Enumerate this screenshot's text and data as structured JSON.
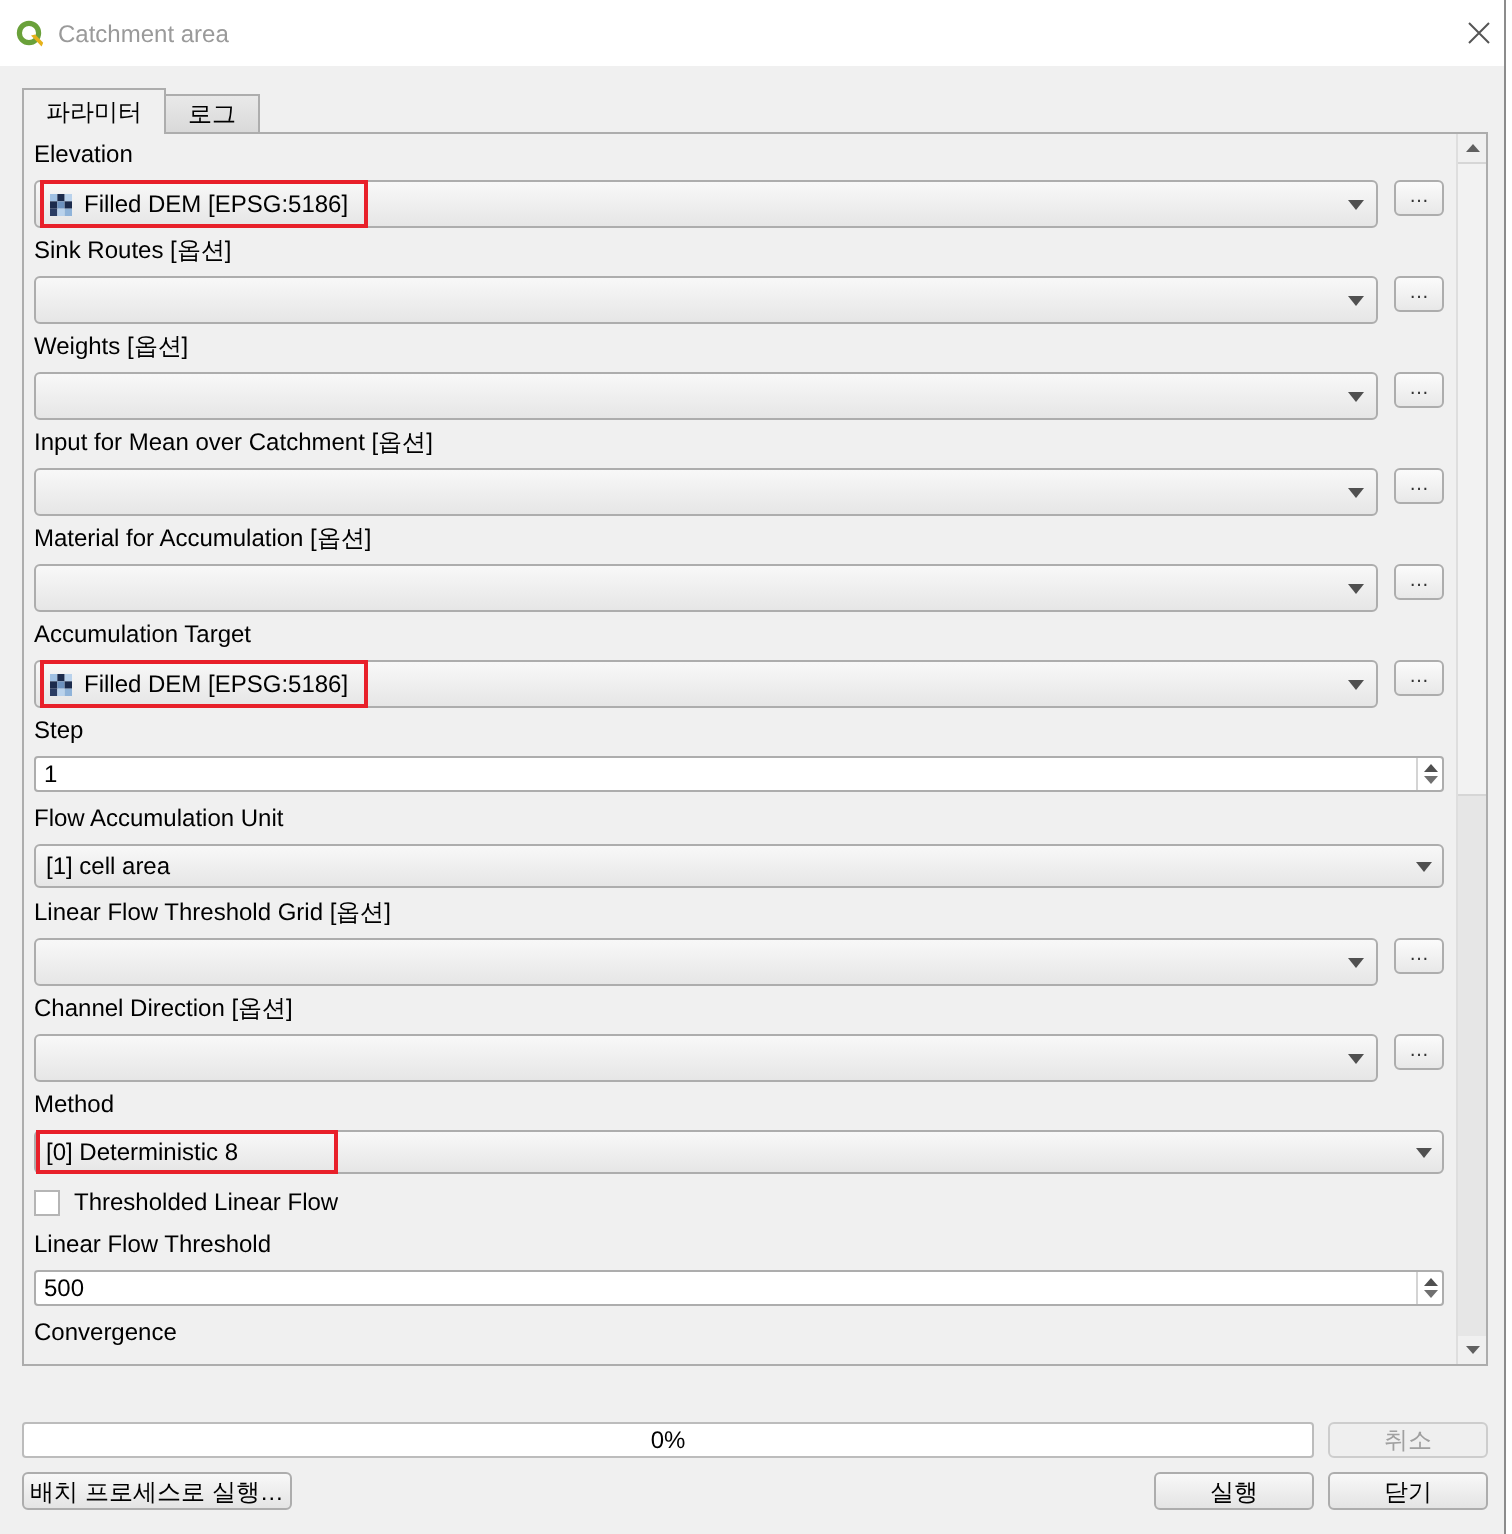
{
  "window": {
    "title": "Catchment area"
  },
  "tabs": [
    {
      "label": "파라미터",
      "selected": true
    },
    {
      "label": "로그",
      "selected": false
    }
  ],
  "parameters": [
    {
      "kind": "layer",
      "label": "Elevation",
      "value": "Filled DEM [EPSG:5186]",
      "highlighted": true,
      "button": "…"
    },
    {
      "kind": "layer",
      "label": "Sink Routes [옵션]",
      "highlighted": false,
      "button": "…"
    },
    {
      "kind": "layer",
      "label": "Weights [옵션]",
      "highlighted": false,
      "button": "…"
    },
    {
      "kind": "layer",
      "label": "Input for Mean over Catchment [옵션]",
      "highlighted": false,
      "button": "…"
    },
    {
      "kind": "layer",
      "label": "Material for Accumulation [옵션]",
      "highlighted": false,
      "button": "…"
    },
    {
      "kind": "layer",
      "label": "Accumulation Target",
      "value": "Filled DEM [EPSG:5186]",
      "highlighted": true,
      "button": "…"
    },
    {
      "kind": "number",
      "label": "Step",
      "value": "1"
    },
    {
      "kind": "enum",
      "label": "Flow Accumulation Unit",
      "value": "[1] cell area",
      "highlighted": false
    },
    {
      "kind": "layer",
      "label": "Linear Flow Threshold Grid [옵션]",
      "highlighted": false,
      "button": "…"
    },
    {
      "kind": "layer",
      "label": "Channel Direction [옵션]",
      "highlighted": false,
      "button": "…"
    },
    {
      "kind": "enum",
      "label": "Method",
      "value": "[0] Deterministic 8",
      "highlighted": true
    },
    {
      "kind": "checkbox",
      "label": "Thresholded Linear Flow",
      "checked": false
    },
    {
      "kind": "number",
      "label": "Linear Flow Threshold",
      "value": "500"
    },
    {
      "kind": "label",
      "label": "Convergence"
    }
  ],
  "progress": {
    "level": 0,
    "text": "0%"
  },
  "cancel_button": {
    "label": "취소",
    "disabled": true
  },
  "footer": {
    "start_buttons": [
      {
        "label": "배치 프로세스로 실행…",
        "disabled": false
      }
    ],
    "end_buttons": [
      {
        "label": "실행",
        "disabled": false
      },
      {
        "label": "닫기",
        "disabled": false
      }
    ]
  }
}
